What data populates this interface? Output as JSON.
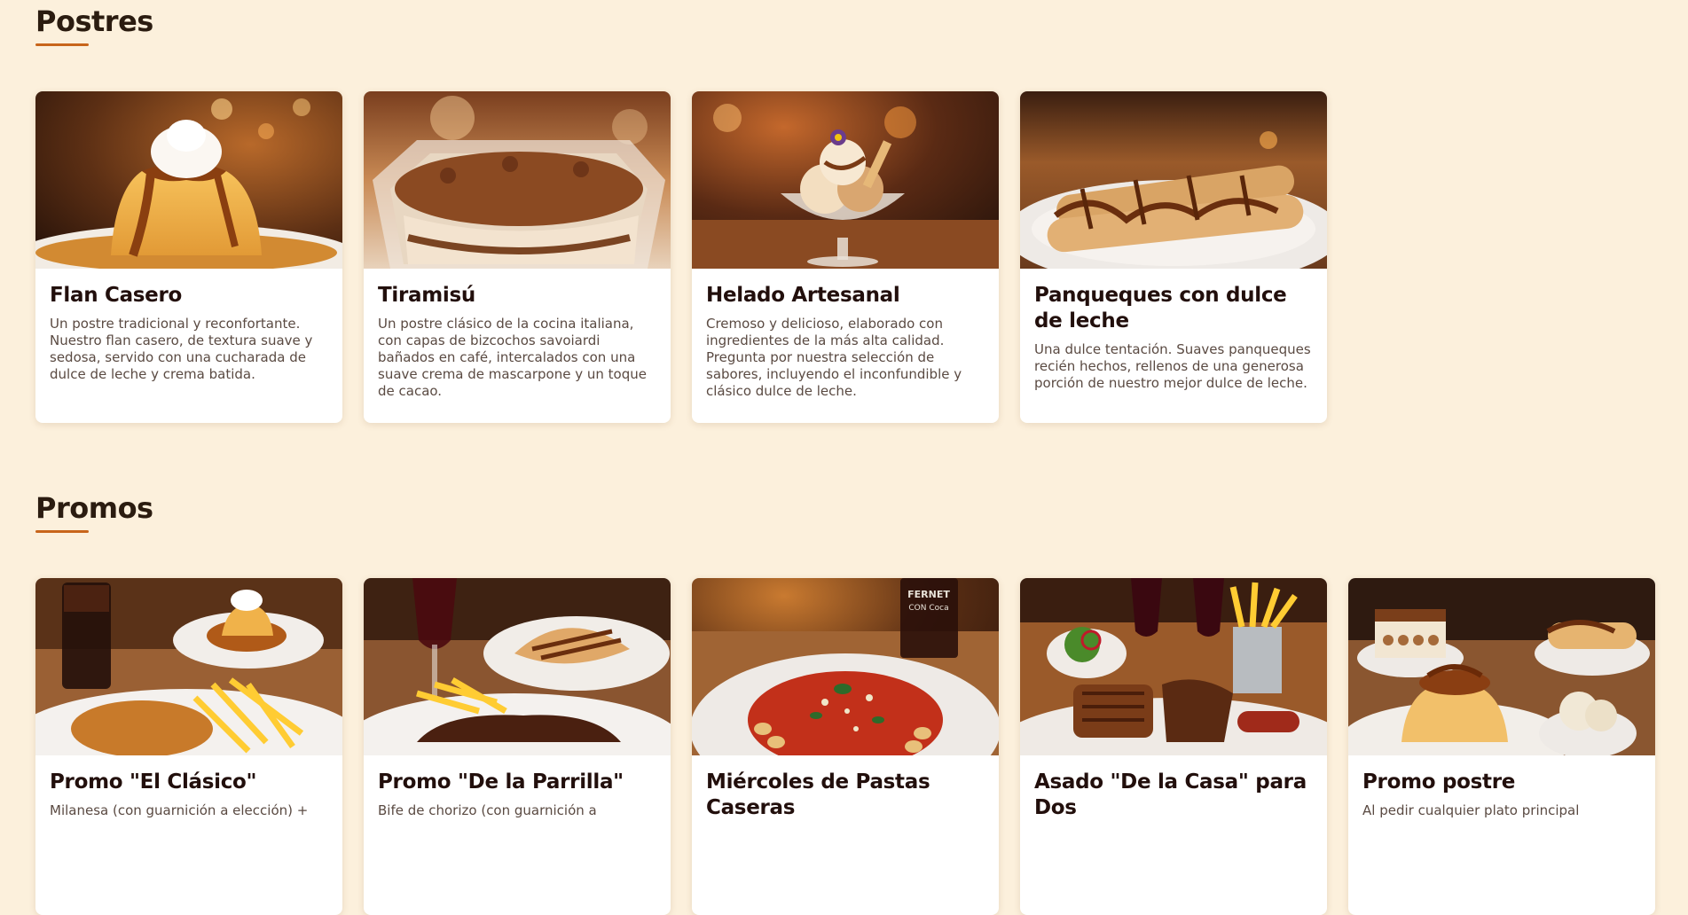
{
  "postres": {
    "title": "Postres",
    "items": [
      {
        "title": "Flan Casero",
        "description": "Un postre tradicional y reconfortante. Nuestro flan casero, de textura suave y sedosa, servido con una cucharada de dulce de leche y crema batida.",
        "image": "flan-photo"
      },
      {
        "title": "Tiramisú",
        "description": "Un postre clásico de la cocina italiana, con capas de bizcochos savoiardi bañados en café, intercalados con una suave crema de mascarpone y un toque de cacao.",
        "image": "tiramisu-photo"
      },
      {
        "title": "Helado Artesanal",
        "description": "Cremoso y delicioso, elaborado con ingredientes de la más alta calidad. Pregunta por nuestra selección de sabores, incluyendo el inconfundible y clásico dulce de leche.",
        "image": "ice-cream-photo"
      },
      {
        "title": "Panqueques con dulce de leche",
        "description": "Una dulce tentación. Suaves panqueques recién hechos, rellenos de una generosa porción de nuestro mejor dulce de leche.",
        "image": "crepes-photo"
      }
    ]
  },
  "promos": {
    "title": "Promos",
    "items": [
      {
        "title": "Promo \"El Clásico\"",
        "description": "Milanesa (con guarnición a elección) +",
        "image": "milanesa-combo-photo"
      },
      {
        "title": "Promo \"De la Parrilla\"",
        "description": "Bife de chorizo (con guarnición a",
        "image": "steak-combo-photo"
      },
      {
        "title": "Miércoles de Pastas Caseras",
        "description": "",
        "image": "pasta-photo"
      },
      {
        "title": "Asado \"De la Casa\" para Dos",
        "description": "",
        "image": "asado-photo"
      },
      {
        "title": "Promo postre",
        "description": "Al pedir cualquier plato principal",
        "image": "desserts-photo"
      }
    ]
  },
  "image_text": {
    "fernet_can": "FERNET CON Coca"
  },
  "colors": {
    "background": "#fcf0dc",
    "accent": "#c8651b",
    "title": "#220f0c",
    "text": "#5a4a42"
  }
}
